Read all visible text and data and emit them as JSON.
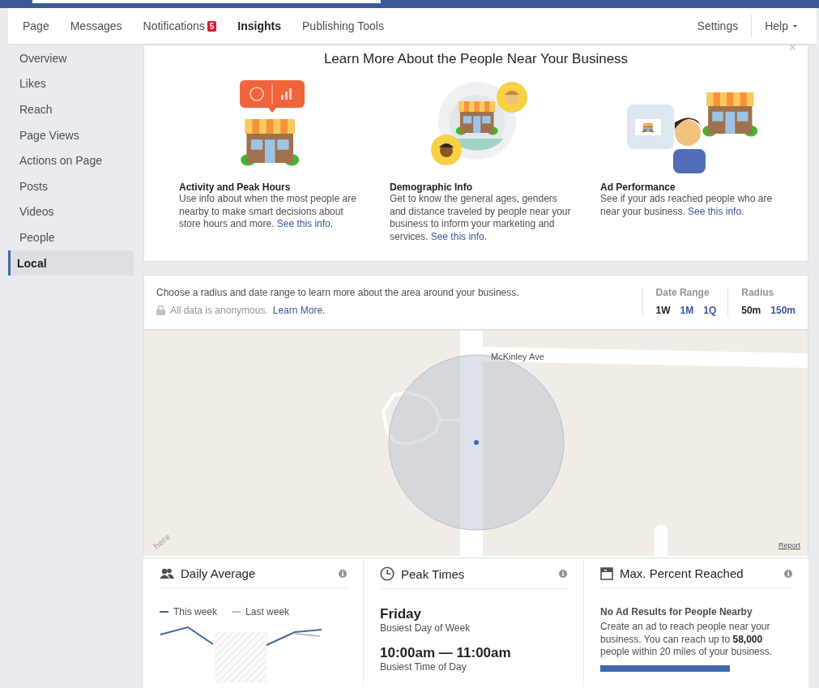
{
  "nav": {
    "tabs": [
      {
        "label": "Page",
        "selected": false
      },
      {
        "label": "Messages",
        "selected": false
      },
      {
        "label": "Notifications",
        "selected": false,
        "badge": "5"
      },
      {
        "label": "Insights",
        "selected": true
      },
      {
        "label": "Publishing Tools",
        "selected": false
      }
    ],
    "right": [
      {
        "label": "Settings",
        "caret": false
      },
      {
        "label": "Help",
        "caret": true
      }
    ]
  },
  "sidebar": {
    "items": [
      {
        "label": "Overview",
        "selected": false
      },
      {
        "label": "Likes",
        "selected": false
      },
      {
        "label": "Reach",
        "selected": false
      },
      {
        "label": "Page Views",
        "selected": false
      },
      {
        "label": "Actions on Page",
        "selected": false
      },
      {
        "label": "Posts",
        "selected": false
      },
      {
        "label": "Videos",
        "selected": false
      },
      {
        "label": "People",
        "selected": false
      },
      {
        "label": "Local",
        "selected": true
      }
    ]
  },
  "intro": {
    "title": "Learn More About the People Near Your Business",
    "close": "×",
    "features": [
      {
        "kind": "activity",
        "title": "Activity and Peak Hours",
        "text": "Use info about when the most people are nearby to make smart decisions about store hours and more.",
        "link": "See this info."
      },
      {
        "kind": "demographic",
        "title": "Demographic Info",
        "text": "Get to know the general ages, genders and distance traveled by people near your business to inform your marketing and services.",
        "link": "See this info."
      },
      {
        "kind": "ads",
        "title": "Ad Performance",
        "text": "See if your ads reached people who are near your business.",
        "link": "See this info."
      }
    ]
  },
  "filters": {
    "description": "Choose a radius and date range to learn more about the area around your business.",
    "privacy": "All data is anonymous.",
    "privacy_link": "Learn More.",
    "groups": [
      {
        "label": "Date Range",
        "options": [
          {
            "label": "1W",
            "selected": true
          },
          {
            "label": "1M",
            "selected": false
          },
          {
            "label": "1Q",
            "selected": false
          }
        ]
      },
      {
        "label": "Radius",
        "options": [
          {
            "label": "50m",
            "selected": true
          },
          {
            "label": "150m",
            "selected": false
          }
        ]
      }
    ]
  },
  "map": {
    "street": "McKinley Ave",
    "logo": "here",
    "report": "Report"
  },
  "cards": [
    {
      "kind": "daily",
      "title": "Daily Average",
      "legend": [
        {
          "label": "This week",
          "color": "#4b67a1"
        },
        {
          "label": "Last week",
          "color": "#bcc0c9"
        }
      ]
    },
    {
      "kind": "peak",
      "title": "Peak Times",
      "stats": [
        {
          "value": "Friday",
          "caption": "Busiest Day of Week"
        },
        {
          "value": "10:00am — 11:00am",
          "caption": "Busiest Time of Day"
        }
      ]
    },
    {
      "kind": "reach",
      "title": "Max. Percent Reached",
      "heading": "No Ad Results for People Nearby",
      "text": "Create an ad to reach people near your business. You can reach up to **58,000** people within 20 miles of your business."
    }
  ]
}
